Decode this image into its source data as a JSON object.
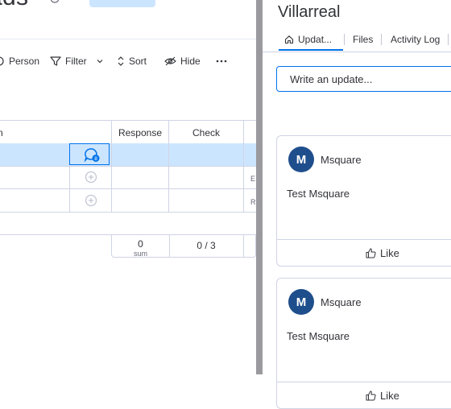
{
  "board": {
    "title": "ads",
    "toolbar": {
      "person": "Person",
      "filter": "Filter",
      "sort": "Sort",
      "hide": "Hide"
    },
    "columns": [
      "n",
      "Response",
      "Check"
    ],
    "rows": [
      {
        "selected": true,
        "badge": "8",
        "tail": ""
      },
      {
        "selected": false,
        "badge": "",
        "tail": "E"
      },
      {
        "selected": false,
        "badge": "",
        "tail": "R"
      }
    ],
    "summary": {
      "response_value": "0",
      "response_label": "sum",
      "check_value": "0 / 3"
    }
  },
  "panel": {
    "title": "Villarreal",
    "tabs": [
      {
        "label": "Updat...",
        "active": true
      },
      {
        "label": "Files",
        "active": false
      },
      {
        "label": "Activity Log",
        "active": false
      }
    ],
    "input_placeholder": "Write an update...",
    "updates": [
      {
        "avatar": "M",
        "author": "Msquare",
        "body": "Test Msquare",
        "like": "Like"
      },
      {
        "avatar": "M",
        "author": "Msquare",
        "body": "Test Msquare",
        "like": "Like"
      }
    ]
  },
  "colors": {
    "accent": "#0073ea",
    "selected_row": "#cce5ff",
    "avatar": "#1f4e8c",
    "border": "#d0d4e4",
    "splitter": "#9a9a9e"
  }
}
